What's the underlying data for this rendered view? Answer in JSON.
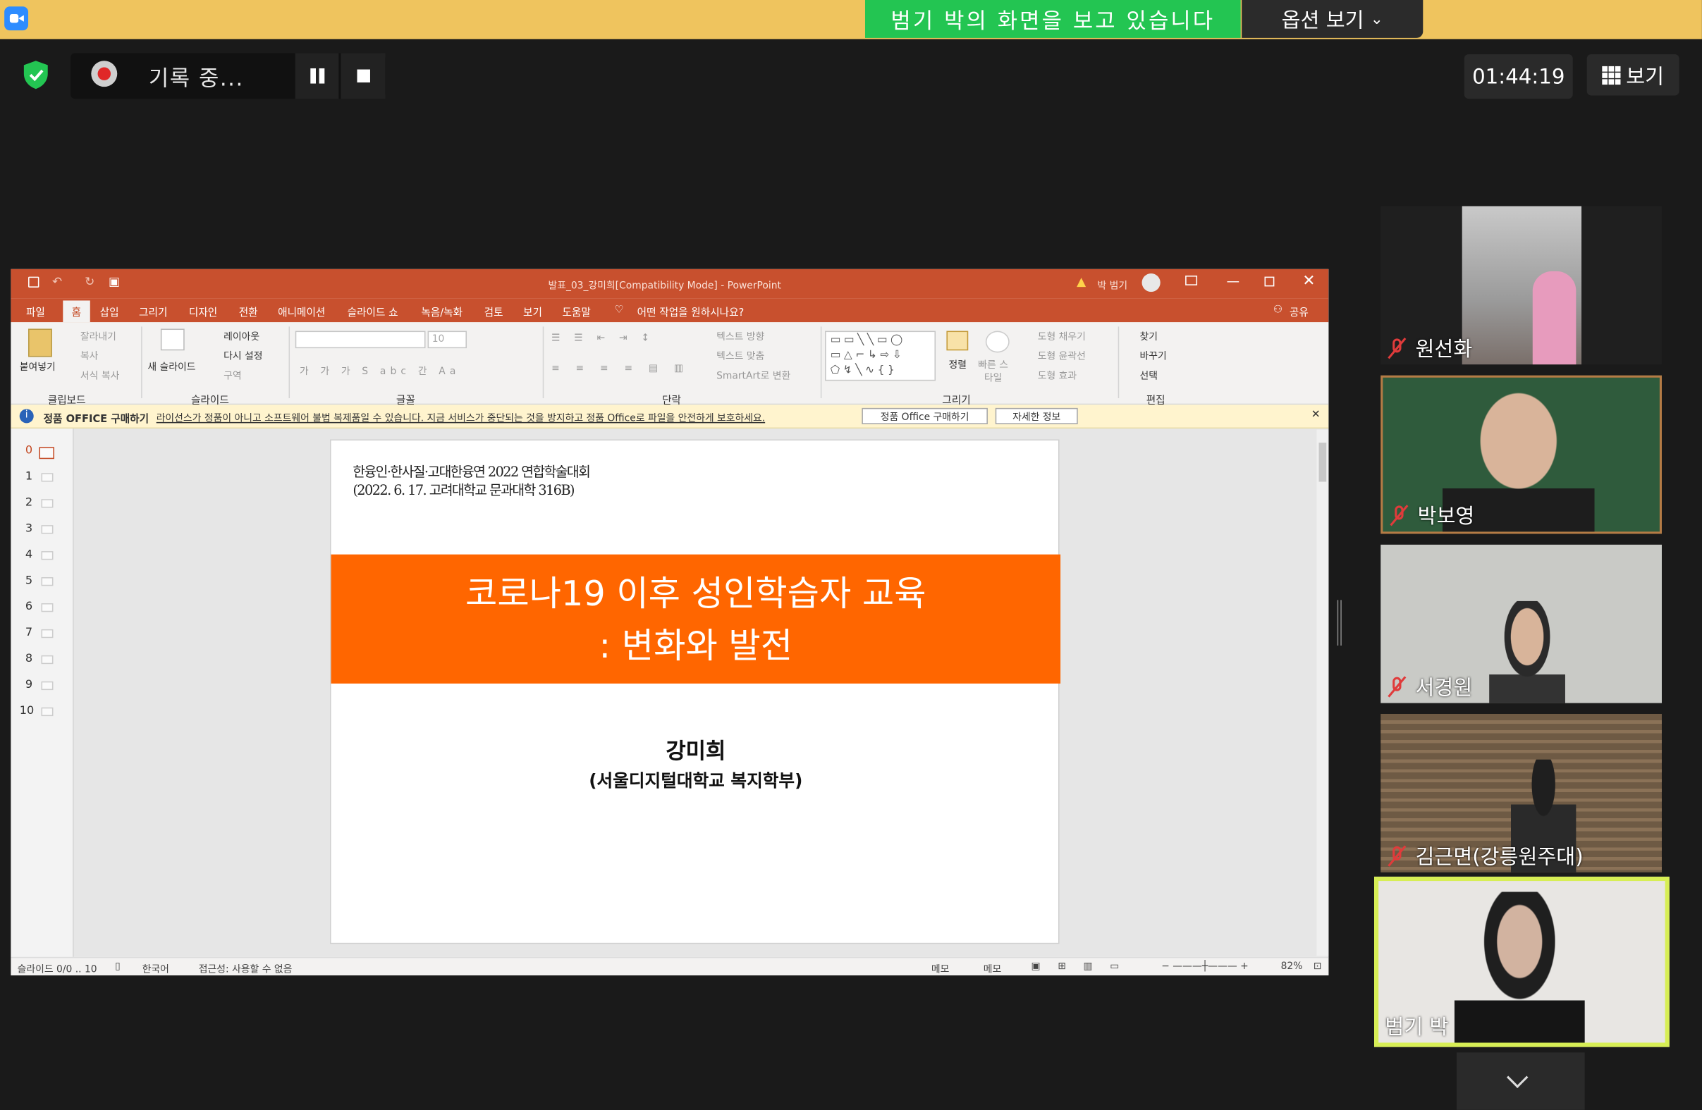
{
  "zoom": {
    "viewing_banner": "범기 박의 화면을 보고 있습니다",
    "view_options": "옵션 보기",
    "recording_label": "기록 중...",
    "timer": "01:44:19",
    "view_button": "보기"
  },
  "participants": [
    {
      "name": "원선화",
      "muted": true
    },
    {
      "name": "박보영",
      "muted": true
    },
    {
      "name": "서경원",
      "muted": true
    },
    {
      "name": "김근면(강릉원주대)",
      "muted": true
    },
    {
      "name": "범기 박",
      "muted": false,
      "active_speaker": true
    }
  ],
  "powerpoint": {
    "window_title": "발표_03_강미희[Compatibility Mode]  -  PowerPoint",
    "user_name": "박 범기",
    "tabs": [
      "파일",
      "홈",
      "삽입",
      "그리기",
      "디자인",
      "전환",
      "애니메이션",
      "슬라이드 쇼",
      "녹음/녹화",
      "검토",
      "보기",
      "도움말"
    ],
    "tell_me": "어떤 작업을 원하시나요?",
    "share": "공유",
    "ribbon": {
      "clipboard": {
        "paste": "붙여넣기",
        "cut": "잘라내기",
        "copy": "복사",
        "format_painter": "서식 복사",
        "group": "클립보드"
      },
      "slides": {
        "new_slide": "새 슬라이드",
        "layout": "레이아웃",
        "reset": "다시 설정",
        "section": "구역",
        "group": "슬라이드"
      },
      "font": {
        "size": "10",
        "group": "글꼴"
      },
      "paragraph": {
        "text_direction": "텍스트 방향",
        "align_text": "텍스트 맞춤",
        "smartart": "SmartArt로 변환",
        "group": "단락"
      },
      "drawing": {
        "arrange": "정렬",
        "quick_styles": "빠른 스타일",
        "shape_fill": "도형 채우기",
        "shape_outline": "도형 윤곽선",
        "shape_effects": "도형 효과",
        "group": "그리기"
      },
      "editing": {
        "find": "찾기",
        "replace": "바꾸기",
        "select": "선택",
        "group": "편집"
      }
    },
    "infobar": {
      "title": "정품 OFFICE 구매하기",
      "message": "라이선스가 정품이 아니고 소프트웨어 불법 복제품일 수 있습니다. 지금 서비스가 중단되는 것을 방지하고 정품 Office로 파일을 안전하게 보호하세요.",
      "buy_button": "정품 Office 구매하기",
      "more_button": "자세한 정보"
    },
    "thumbnails": [
      "0",
      "1",
      "2",
      "3",
      "4",
      "5",
      "6",
      "7",
      "8",
      "9",
      "10"
    ],
    "slide": {
      "subtitle_line1": "한융인·한사질·고대한융연 2022 연합학술대회",
      "subtitle_line2": "(2022. 6. 17. 고려대학교 문과대학 316B)",
      "title_line1": "코로나19 이후 성인학습자 교육",
      "title_line2": ": 변화와 발전",
      "author": "강미희",
      "affiliation": "(서울디지털대학교 복지학부)"
    },
    "status": {
      "slide_info": "슬라이드 0/0 .. 10",
      "language": "한국어",
      "accessibility": "접근성: 사용할 수 없음",
      "notes": "메모",
      "comments": "메모",
      "zoom": "82%"
    }
  },
  "colors": {
    "accent_orange": "#ff6600",
    "ppt_red": "#c8502e",
    "zoom_green": "#23c552",
    "zoom_banner": "#efc45e"
  }
}
